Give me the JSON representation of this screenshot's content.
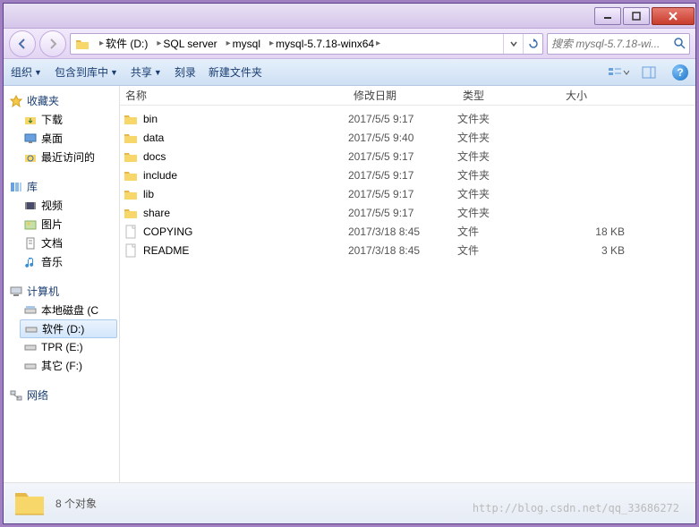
{
  "titlebar": {
    "min": "–",
    "max": "☐",
    "close": "✕"
  },
  "nav": {
    "back": "←",
    "fwd": "→",
    "crumbs": [
      "软件 (D:)",
      "SQL server",
      "mysql",
      "mysql-5.7.18-winx64"
    ],
    "refresh": "↻",
    "search_placeholder": "搜索 mysql-5.7.18-wi..."
  },
  "toolbar": {
    "organize": "组织",
    "include": "包含到库中",
    "share": "共享",
    "burn": "刻录",
    "newfolder": "新建文件夹",
    "dd": "▼"
  },
  "navpane": {
    "favorites": {
      "label": "收藏夹",
      "items": [
        "下载",
        "桌面",
        "最近访问的"
      ]
    },
    "libraries": {
      "label": "库",
      "items": [
        "视频",
        "图片",
        "文档",
        "音乐"
      ]
    },
    "computer": {
      "label": "计算机",
      "items": [
        "本地磁盘 (C",
        "软件 (D:)",
        "TPR (E:)",
        "其它 (F:)"
      ]
    },
    "network": {
      "label": "网络"
    }
  },
  "columns": {
    "name": "名称",
    "date": "修改日期",
    "type": "类型",
    "size": "大小"
  },
  "files": [
    {
      "name": "bin",
      "date": "2017/5/5 9:17",
      "type": "文件夹",
      "size": "",
      "icon": "folder"
    },
    {
      "name": "data",
      "date": "2017/5/5 9:40",
      "type": "文件夹",
      "size": "",
      "icon": "folder"
    },
    {
      "name": "docs",
      "date": "2017/5/5 9:17",
      "type": "文件夹",
      "size": "",
      "icon": "folder"
    },
    {
      "name": "include",
      "date": "2017/5/5 9:17",
      "type": "文件夹",
      "size": "",
      "icon": "folder"
    },
    {
      "name": "lib",
      "date": "2017/5/5 9:17",
      "type": "文件夹",
      "size": "",
      "icon": "folder"
    },
    {
      "name": "share",
      "date": "2017/5/5 9:17",
      "type": "文件夹",
      "size": "",
      "icon": "folder"
    },
    {
      "name": "COPYING",
      "date": "2017/3/18 8:45",
      "type": "文件",
      "size": "18 KB",
      "icon": "file"
    },
    {
      "name": "README",
      "date": "2017/3/18 8:45",
      "type": "文件",
      "size": "3 KB",
      "icon": "file"
    }
  ],
  "status": {
    "text": "8 个对象"
  },
  "watermark": "http://blog.csdn.net/qq_33686272"
}
